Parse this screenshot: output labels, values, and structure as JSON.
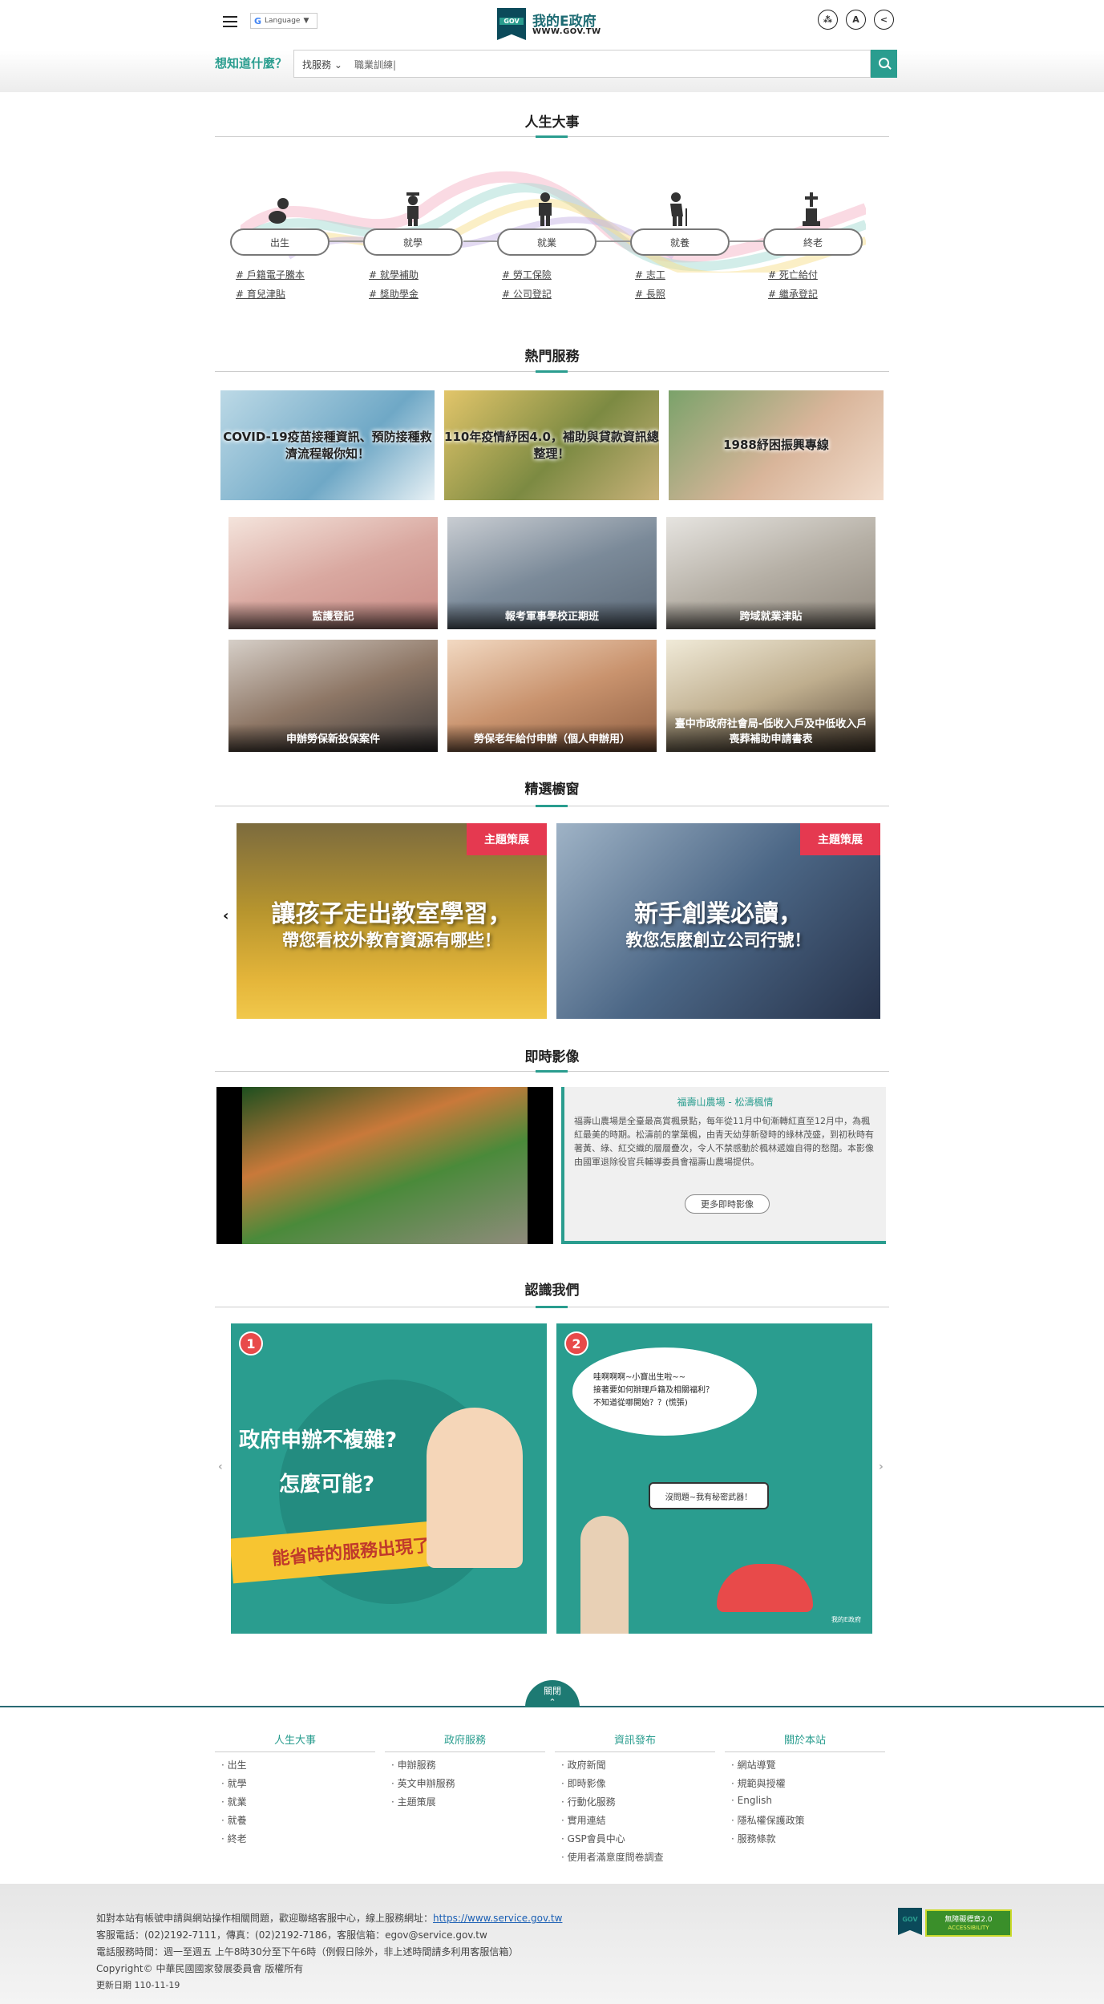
{
  "header": {
    "language_label": "Language",
    "logo_badge": "GOV",
    "logo_title": "我的E政府",
    "logo_url": "WWW.GOV.TW",
    "search_prompt": "想知道什麼？",
    "search_select": "找服務",
    "search_value": "職業訓練|",
    "accent": "#2a9d8f"
  },
  "life": {
    "title": "人生大事",
    "stages": [
      {
        "label": "出生",
        "tags": [
          "# 戶籍電子騰本",
          "# 育兒津貼"
        ]
      },
      {
        "label": "就學",
        "tags": [
          "# 就學補助",
          "# 獎助學金"
        ]
      },
      {
        "label": "就業",
        "tags": [
          "# 勞工保險",
          "# 公司登記"
        ]
      },
      {
        "label": "就養",
        "tags": [
          "# 志工",
          "# 長照"
        ]
      },
      {
        "label": "終老",
        "tags": [
          "# 死亡給付",
          "# 繼承登記"
        ]
      }
    ]
  },
  "hot": {
    "title": "熱門服務",
    "slides": [
      "COVID-19疫苗接種資訊、預防接種救濟流程報你知！",
      "110年疫情紓困4.0，補助與貸款資訊總整理！",
      "1988紓困振興專線"
    ],
    "cards": [
      "監護登記",
      "報考軍事學校正期班",
      "跨域就業津貼",
      "申辦勞保新投保案件",
      "勞保老年給付申辦（個人申辦用）",
      "臺中市政府社會局-低收入戶及中低收入戶喪葬補助申請書表"
    ]
  },
  "featured": {
    "title": "精選櫥窗",
    "items": [
      {
        "ribbon": "主題策展",
        "line1": "讓孩子走出教室學習，",
        "line2": "帶您看校外教育資源有哪些！"
      },
      {
        "ribbon": "主題策展",
        "line1": "新手創業必讀，",
        "line2": "教您怎麼創立公司行號！"
      }
    ]
  },
  "video": {
    "title": "即時影像",
    "heading": "福壽山農場 - 松濤楓情",
    "text": "福壽山農場是全臺最高賞楓景點，每年從11月中旬漸轉紅直至12月中，為楓紅最美的時期。松濤前的掌葉楓，由青天幼芽新發時的綠林茂盛，到初秋時有著黃、綠、紅交織的層層疊次，令人不禁感動於楓林遞嬗自得的愁闊。本影像由國軍退除役官兵輔導委員會福壽山農場提供。",
    "more": "更多即時影像"
  },
  "about": {
    "title": "認識我們",
    "cards": [
      {
        "num": "1",
        "l1": "政府申辦不複雜?",
        "l2": "怎麼可能?",
        "l3": "能省時的服務出現了!"
      },
      {
        "num": "2",
        "bubble": "哇啊啊啊~小寶出生啦~~\n接著要如何辦理戶籍及相關福利？\n不知道從哪開始？？(慌張)",
        "reply": "沒問題~我有秘密武器！",
        "brand": "我的E政府"
      }
    ]
  },
  "footer": {
    "toggle": "關閉",
    "cols": [
      {
        "title": "人生大事",
        "links": [
          "出生",
          "就學",
          "就業",
          "就養",
          "終老"
        ]
      },
      {
        "title": "政府服務",
        "links": [
          "申辦服務",
          "英文申辦服務",
          "主題策展"
        ]
      },
      {
        "title": "資訊發布",
        "links": [
          "政府新聞",
          "即時影像",
          "行動化服務",
          "實用連結",
          "GSP會員中心",
          "使用者滿意度問卷調查"
        ]
      },
      {
        "title": "關於本站",
        "links": [
          "網站導覽",
          "規範與授權",
          "English",
          "隱私權保護政策",
          "服務條款"
        ]
      }
    ],
    "contact": [
      "如對本站有帳號申請與網站操作相關問題，歡迎聯絡客服中心，線上服務網址：",
      "客服電話：(02)2192-7111，傳真：(02)2192-7186，客服信箱：egov@service.gov.tw",
      "電話服務時間：週一至週五  上午8時30分至下午6時（例假日除外，非上述時間請多利用客服信箱）",
      "Copyright© 中華民國國家發展委員會 版權所有",
      "更新日期 110-11-19"
    ],
    "service_url": "https://www.service.gov.tw",
    "badge_gov": "GOV",
    "badge_access": "無障礙標章2.0",
    "badge_access_sub": "ACCESSIBILITY"
  }
}
